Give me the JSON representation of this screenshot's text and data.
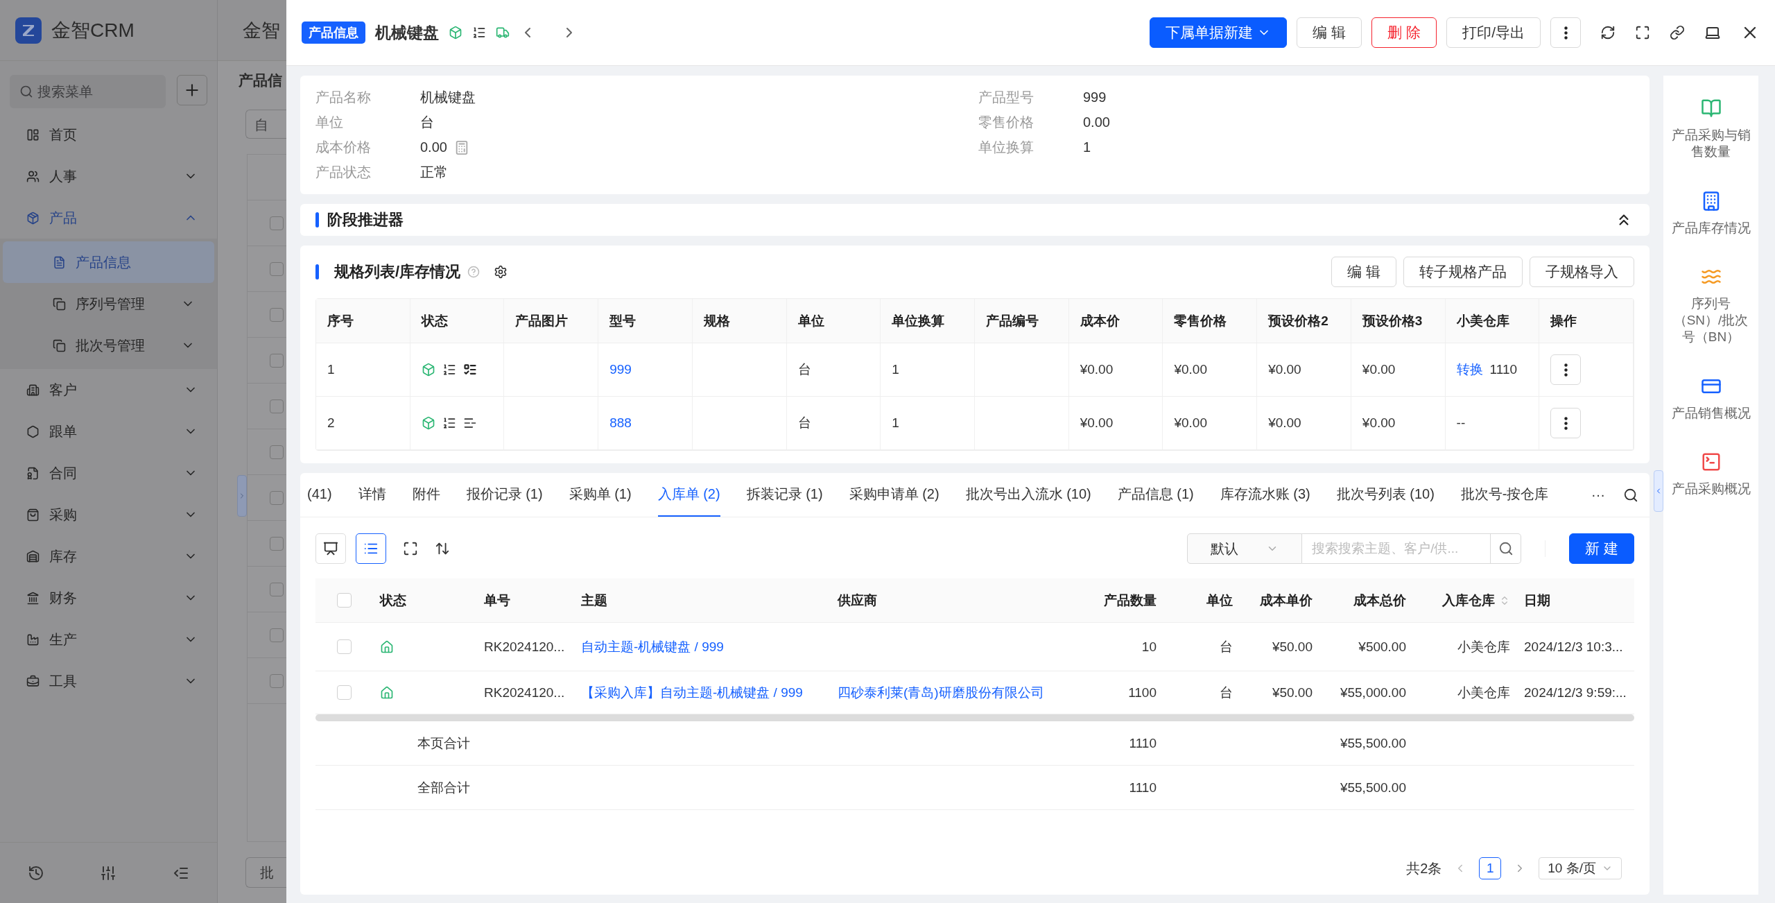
{
  "sidebar": {
    "brand": "金智CRM",
    "search_placeholder": "搜索菜单",
    "items": [
      {
        "label": "首页",
        "kind": "link",
        "selected": false
      },
      {
        "label": "人事",
        "kind": "group",
        "expanded": false,
        "selected": false
      },
      {
        "label": "产品",
        "kind": "group",
        "expanded": true,
        "selected": true,
        "children": [
          {
            "label": "产品信息",
            "kind": "link",
            "selected": true
          },
          {
            "label": "序列号管理",
            "kind": "group",
            "expanded": false,
            "selected": false
          },
          {
            "label": "批次号管理",
            "kind": "group",
            "expanded": false,
            "selected": false
          }
        ]
      },
      {
        "label": "客户",
        "kind": "group",
        "expanded": false,
        "selected": false
      },
      {
        "label": "跟单",
        "kind": "group",
        "expanded": false,
        "selected": false
      },
      {
        "label": "合同",
        "kind": "group",
        "expanded": false,
        "selected": false
      },
      {
        "label": "采购",
        "kind": "group",
        "expanded": false,
        "selected": false
      },
      {
        "label": "库存",
        "kind": "group",
        "expanded": false,
        "selected": false
      },
      {
        "label": "财务",
        "kind": "group",
        "expanded": false,
        "selected": false
      },
      {
        "label": "生产",
        "kind": "group",
        "expanded": false,
        "selected": false
      },
      {
        "label": "工具",
        "kind": "group",
        "expanded": false,
        "selected": false
      }
    ]
  },
  "background_page": {
    "header_title": "金智",
    "page_title": "产品信",
    "filter_text": "自",
    "footer_button": "批",
    "rows": [
      {
        "checked": false
      },
      {
        "checked": false
      },
      {
        "checked": false
      },
      {
        "checked": false
      },
      {
        "checked": false
      },
      {
        "checked": false
      },
      {
        "checked": false
      },
      {
        "checked": false
      },
      {
        "checked": false
      },
      {
        "checked": false
      },
      {
        "checked": false
      }
    ]
  },
  "drawer": {
    "tag": "产品信息",
    "title": "机械键盘",
    "actions": [
      {
        "label": "下属单据新建",
        "kind": "primary"
      },
      {
        "label": "编 辑",
        "kind": "default"
      },
      {
        "label": "删 除",
        "kind": "danger"
      },
      {
        "label": "打印/导出",
        "kind": "default"
      }
    ],
    "info": {
      "left": [
        {
          "label": "产品名称",
          "value": "机械键盘",
          "calculator": false
        },
        {
          "label": "单位",
          "value": "台",
          "calculator": false
        },
        {
          "label": "成本价格",
          "value": "0.00",
          "calculator": true
        },
        {
          "label": "产品状态",
          "value": "正常",
          "calculator": false
        }
      ],
      "right": [
        {
          "label": "产品型号",
          "value": "999",
          "calculator": false
        },
        {
          "label": "零售价格",
          "value": "0.00",
          "calculator": false
        },
        {
          "label": "单位换算",
          "value": "1",
          "calculator": false
        }
      ]
    },
    "stage": {
      "title": "阶段推进器"
    },
    "spec": {
      "title": "规格列表/库存情况",
      "buttons": [
        "编 辑",
        "转子规格产品",
        "子规格导入"
      ],
      "columns": [
        "序号",
        "状态",
        "产品图片",
        "型号",
        "规格",
        "单位",
        "单位换算",
        "产品编号",
        "成本价",
        "零售价格",
        "预设价格2",
        "预设价格3",
        "小美仓库",
        "操作"
      ],
      "rows": [
        {
          "index": "1",
          "batch": true,
          "model": "999",
          "unit": "台",
          "conversion": "1",
          "cost": "¥0.00",
          "retail": "¥0.00",
          "preset2": "¥0.00",
          "preset3": "¥0.00",
          "warehouse_link": "转换",
          "warehouse": "1110"
        },
        {
          "index": "2",
          "batch": false,
          "model": "888",
          "unit": "台",
          "conversion": "1",
          "cost": "¥0.00",
          "retail": "¥0.00",
          "preset2": "¥0.00",
          "preset3": "¥0.00",
          "warehouse": "--"
        }
      ]
    },
    "tabs": [
      {
        "label": "(41)",
        "selected": false
      },
      {
        "label": "详情",
        "selected": false
      },
      {
        "label": "附件",
        "selected": false
      },
      {
        "label": "报价记录 (1)",
        "selected": false
      },
      {
        "label": "采购单 (1)",
        "selected": false
      },
      {
        "label": "入库单 (2)",
        "selected": true
      },
      {
        "label": "拆装记录 (1)",
        "selected": false
      },
      {
        "label": "采购申请单 (2)",
        "selected": false
      },
      {
        "label": "批次号出入流水 (10)",
        "selected": false
      },
      {
        "label": "产品信息 (1)",
        "selected": false
      },
      {
        "label": "库存流水账 (3)",
        "selected": false
      },
      {
        "label": "批次号列表 (10)",
        "selected": false
      },
      {
        "label": "批次号-按仓库",
        "selected": false
      }
    ],
    "tabs_more": "···",
    "view_modes": [
      {
        "selected": false
      },
      {
        "selected": true
      }
    ],
    "filter": {
      "select": "默认",
      "search_placeholder": "搜索搜索主题、客户/供...",
      "new_button": "新 建"
    },
    "table": {
      "columns": [
        {
          "label": "状态",
          "sortable": false
        },
        {
          "label": "单号",
          "sortable": false
        },
        {
          "label": "主题",
          "sortable": false
        },
        {
          "label": "供应商",
          "sortable": false
        },
        {
          "label": "产品数量",
          "sortable": false
        },
        {
          "label": "单位",
          "sortable": false
        },
        {
          "label": "成本单价",
          "sortable": false
        },
        {
          "label": "成本总价",
          "sortable": false
        },
        {
          "label": "入库仓库",
          "sortable": true
        },
        {
          "label": "日期",
          "sortable": false
        }
      ],
      "all_checked": false,
      "rows": [
        {
          "checked": false,
          "number": "RK2024120...",
          "subject": "自动主题-机械键盘 / 999",
          "quantity": "10",
          "unit": "台",
          "unit_cost": "¥50.00",
          "total_cost": "¥500.00",
          "warehouse": "小美仓库",
          "date": "2024/12/3 10:3..."
        },
        {
          "checked": false,
          "number": "RK2024120...",
          "subject": "【采购入库】自动主题-机械键盘 / 999",
          "supplier": "四砂泰利莱(青岛)研磨股份有限公司",
          "quantity": "1100",
          "unit": "台",
          "unit_cost": "¥50.00",
          "total_cost": "¥55,000.00",
          "warehouse": "小美仓库",
          "date": "2024/12/3 9:59:..."
        }
      ],
      "summaries": [
        {
          "label": "本页合计",
          "quantity": "1110",
          "total_cost": "¥55,500.00"
        },
        {
          "label": "全部合计",
          "quantity": "1110",
          "total_cost": "¥55,500.00"
        }
      ]
    },
    "pagination": {
      "total": "共2条",
      "pages": [
        {
          "label": "1",
          "selected": true
        }
      ],
      "page_size": "10 条/页"
    },
    "side_panel": [
      {
        "label": "产品采购与销售数量"
      },
      {
        "label": "产品库存情况"
      },
      {
        "label": "序列号（SN）/批次号（BN）"
      },
      {
        "label": "产品销售概况"
      },
      {
        "label": "产品采购概况"
      }
    ]
  }
}
